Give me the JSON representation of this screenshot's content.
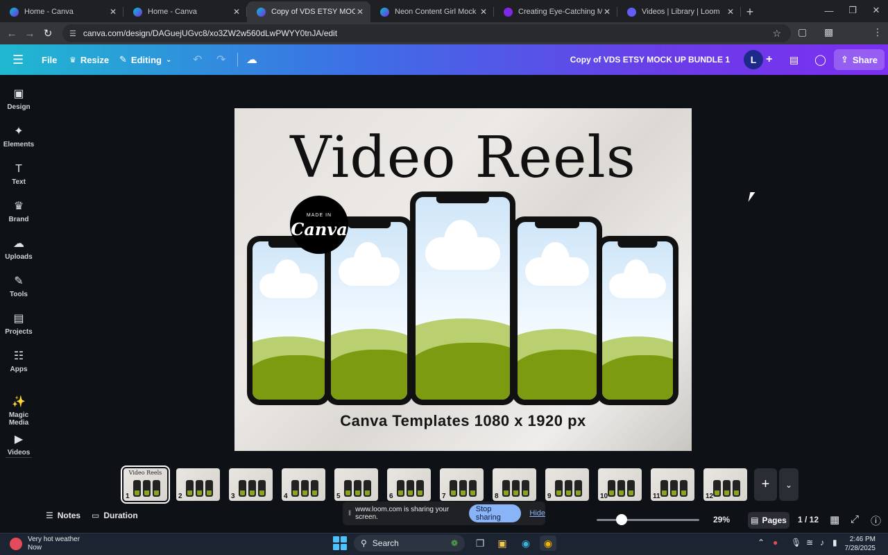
{
  "browser": {
    "tabs": [
      {
        "title": "Home - Canva",
        "favicon": "canva-icon"
      },
      {
        "title": "Home - Canva",
        "favicon": "canva-icon"
      },
      {
        "title": "Copy of VDS ETSY MOCK UP BU",
        "favicon": "canva-icon",
        "active": true
      },
      {
        "title": "Neon Content Girl Mock ups -",
        "favicon": "canva-icon"
      },
      {
        "title": "Creating Eye-Catching Mock-Up",
        "favicon": "neon-icon"
      },
      {
        "title": "Videos | Library | Loom",
        "favicon": "loom-icon"
      }
    ],
    "url": "canva.com/design/DAGuejUGvc8/xo3ZW2w560dLwPWYY0tnJA/edit"
  },
  "toolbar": {
    "file_label": "File",
    "resize_label": "Resize",
    "editing_label": "Editing",
    "doc_title": "Copy of VDS ETSY MOCK UP BUNDLE 1",
    "user_initial": "L",
    "share_label": "Share"
  },
  "sidebar": {
    "items": [
      {
        "label": "Design",
        "icon": "design-icon"
      },
      {
        "label": "Elements",
        "icon": "elements-icon"
      },
      {
        "label": "Text",
        "icon": "text-icon"
      },
      {
        "label": "Brand",
        "icon": "brand-icon"
      },
      {
        "label": "Uploads",
        "icon": "uploads-icon"
      },
      {
        "label": "Tools",
        "icon": "tools-icon"
      },
      {
        "label": "Projects",
        "icon": "projects-icon"
      },
      {
        "label": "Apps",
        "icon": "apps-icon"
      },
      {
        "label": "Magic Media",
        "icon": "magic-media-icon"
      },
      {
        "label": "Videos",
        "icon": "videos-icon"
      }
    ]
  },
  "canvas": {
    "title": "Video Reels",
    "subtitle": "Canva Templates 1080 x 1920 px",
    "badge_small": "MADE IN",
    "badge_large": "Canva"
  },
  "pages": {
    "thumbnails": [
      {
        "num": "1",
        "title": "Video Reels"
      },
      {
        "num": "2",
        "title": ""
      },
      {
        "num": "3",
        "title": ""
      },
      {
        "num": "4",
        "title": ""
      },
      {
        "num": "5",
        "title": ""
      },
      {
        "num": "6",
        "title": ""
      },
      {
        "num": "7",
        "title": ""
      },
      {
        "num": "8",
        "title": ""
      },
      {
        "num": "9",
        "title": ""
      },
      {
        "num": "10",
        "title": ""
      },
      {
        "num": "11",
        "title": ""
      },
      {
        "num": "12",
        "title": ""
      }
    ],
    "selected_index": 0
  },
  "footer": {
    "notes_label": "Notes",
    "duration_label": "Duration",
    "zoom": "29%",
    "pages_label": "Pages",
    "page_count": "1 / 12",
    "zoom_fraction": 0.29
  },
  "loom": {
    "message": "www.loom.com is sharing your screen.",
    "stop_label": "Stop sharing",
    "hide_label": "Hide"
  },
  "taskbar": {
    "weather_title": "Very hot weather",
    "weather_sub": "Now",
    "search_label": "Search",
    "time": "2:46 PM",
    "date": "7/28/2025"
  },
  "colors": {
    "toolbar_start": "#1fb8d0",
    "toolbar_end": "#7b2ff0",
    "phone_grass": "#7d9b10",
    "stop_button": "#8ab4f8"
  }
}
